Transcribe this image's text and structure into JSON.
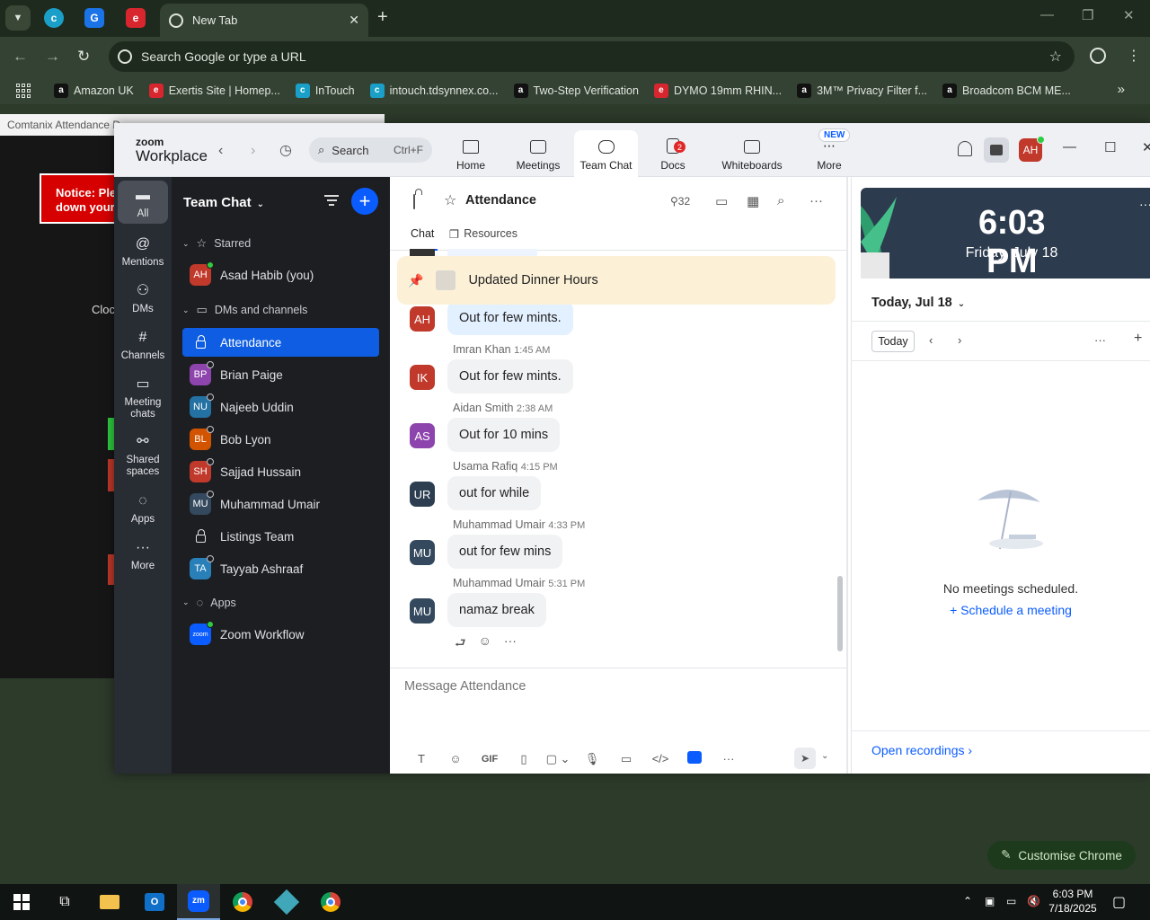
{
  "browser": {
    "active_tab_title": "New Tab",
    "omnibox_placeholder": "Search Google or type a URL",
    "bookmarks": [
      {
        "label": "Amazon UK",
        "icon": "a",
        "color": "#111111"
      },
      {
        "label": "Exertis Site | Homep...",
        "icon": "e",
        "color": "#d8262f"
      },
      {
        "label": "InTouch",
        "icon": "c",
        "color": "#1aa0c8"
      },
      {
        "label": "intouch.tdsynnex.co...",
        "icon": "c",
        "color": "#1aa0c8"
      },
      {
        "label": "Two-Step Verification",
        "icon": "a",
        "color": "#111111"
      },
      {
        "label": "DYMO 19mm RHIN...",
        "icon": "e",
        "color": "#d8262f"
      },
      {
        "label": "3M™ Privacy Filter f...",
        "icon": "a",
        "color": "#111111"
      },
      {
        "label": "Broadcom BCM ME...",
        "icon": "a",
        "color": "#111111"
      }
    ]
  },
  "background_page": {
    "window_title": "Comtanix Attendance D...",
    "notice_line1": "Notice: Ple",
    "notice_line2": "down your",
    "clock_text": "Cloc"
  },
  "zoom": {
    "logo_small": "zoom",
    "logo_big": "Workplace",
    "search_label": "Search",
    "search_shortcut": "Ctrl+F",
    "tabs": [
      {
        "label": "Home"
      },
      {
        "label": "Meetings"
      },
      {
        "label": "Team Chat"
      },
      {
        "label": "Docs",
        "badge": "2"
      },
      {
        "label": "Whiteboards"
      },
      {
        "label": "More",
        "tag": "NEW"
      }
    ],
    "avatar_initials": "AH",
    "rail": [
      {
        "label": "All"
      },
      {
        "label": "Mentions"
      },
      {
        "label": "DMs"
      },
      {
        "label": "Channels"
      },
      {
        "label": "Meeting chats"
      },
      {
        "label": "Shared spaces"
      },
      {
        "label": "Apps"
      },
      {
        "label": "More"
      }
    ],
    "sidebar": {
      "title": "Team Chat",
      "sections": {
        "starred": "Starred",
        "dms": "DMs and channels",
        "apps": "Apps"
      },
      "starred_items": [
        {
          "label": "Asad Habib (you)",
          "initials": "AH",
          "color": "#c0392b"
        }
      ],
      "items": [
        {
          "label": "Attendance",
          "initials": "",
          "color": ""
        },
        {
          "label": "Brian Paige",
          "initials": "BP",
          "color": "#8e44ad"
        },
        {
          "label": "Najeeb Uddin",
          "initials": "NU",
          "color": "#2471a3"
        },
        {
          "label": "Bob Lyon",
          "initials": "BL",
          "color": "#d35400"
        },
        {
          "label": "Sajjad Hussain",
          "initials": "SH",
          "color": "#c0392b"
        },
        {
          "label": "Muhammad Umair",
          "initials": "MU",
          "color": "#34495e"
        },
        {
          "label": "Listings Team",
          "initials": "",
          "color": ""
        },
        {
          "label": "Tayyab Ashraaf",
          "initials": "TA",
          "color": "#2980b9"
        }
      ],
      "apps_items": [
        {
          "label": "Zoom Workflow",
          "initials": "zoom",
          "color": "#0b5cff"
        }
      ]
    },
    "chat": {
      "channel_name": "Attendance",
      "member_count": "32",
      "tabs": {
        "chat": "Chat",
        "resources": "Resources"
      },
      "pinned_text": "Updated Dinner Hours",
      "messages": [
        {
          "sender": "",
          "time": "",
          "initials": "AH",
          "color": "#c0392b",
          "text": "Out for few mints.",
          "self": true
        },
        {
          "sender": "Imran Khan",
          "time": "1:45 AM",
          "initials": "IK",
          "color": "#c0392b",
          "text": "Out for few mints.",
          "self": false
        },
        {
          "sender": "Aidan Smith",
          "time": "2:38 AM",
          "initials": "AS",
          "color": "#8e44ad",
          "text": "Out for 10 mins",
          "self": false
        },
        {
          "sender": "Usama Rafiq",
          "time": "4:15 PM",
          "initials": "UR",
          "color": "#2c3e50",
          "text": "out for while",
          "self": false
        },
        {
          "sender": "Muhammad Umair",
          "time": "4:33 PM",
          "initials": "MU",
          "color": "#34495e",
          "text": "out for few mins",
          "self": false
        },
        {
          "sender": "Muhammad Umair",
          "time": "5:31 PM",
          "initials": "MU",
          "color": "#34495e",
          "text": "namaz break",
          "self": false
        }
      ],
      "composer_placeholder": "Message Attendance"
    },
    "calendar": {
      "time": "6:03 PM",
      "date": "Friday, July 18",
      "heading": "Today, Jul 18",
      "today_button": "Today",
      "empty_text": "No meetings scheduled.",
      "schedule_link": "Schedule a meeting",
      "recordings_link": "Open recordings"
    }
  },
  "customise_chrome": "Customise Chrome",
  "taskbar": {
    "time": "6:03 PM",
    "date": "7/18/2025"
  }
}
